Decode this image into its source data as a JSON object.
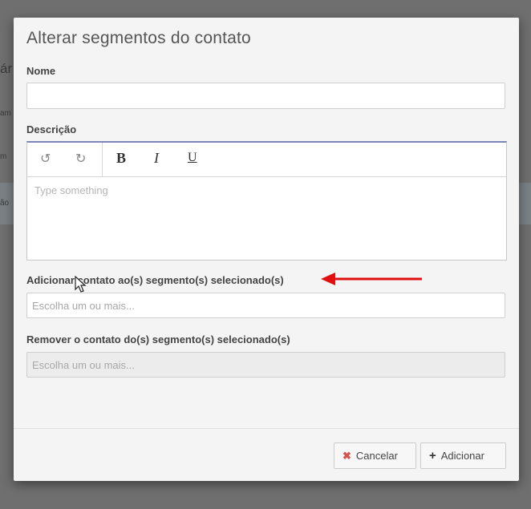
{
  "background": {
    "fragments": [
      "ár",
      "am",
      "m",
      "ão"
    ]
  },
  "modal": {
    "title": "Alterar segmentos do contato",
    "name_field": {
      "label": "Nome",
      "value": ""
    },
    "description": {
      "label": "Descrição",
      "toolbar": {
        "bold": "B",
        "italic": "I",
        "underline": "U"
      },
      "placeholder": "Type something"
    },
    "add_segments": {
      "label": "Adicionar contato ao(s) segmento(s) selecionado(s)",
      "placeholder": "Escolha um ou mais..."
    },
    "remove_segments": {
      "label": "Remover o contato do(s) segmento(s) selecionado(s)",
      "placeholder": "Escolha um ou mais..."
    },
    "buttons": {
      "cancel": "Cancelar",
      "add": "Adicionar"
    }
  },
  "colors": {
    "arrow": "#e01010",
    "cancel_icon": "#d9534f",
    "editor_accent": "#7a86b8"
  },
  "icons": [
    "undo-icon",
    "redo-icon",
    "close-icon",
    "plus-icon",
    "red-arrow-annotation",
    "mouse-cursor"
  ]
}
